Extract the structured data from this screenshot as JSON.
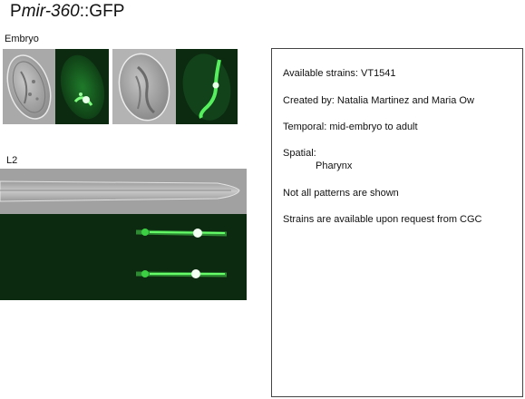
{
  "header": {
    "prefix": "P",
    "gene": "mir-360",
    "suffix": "::GFP"
  },
  "sections": {
    "embryo_label": "Embryo",
    "l2_label": "L2"
  },
  "info": {
    "strains": "Available strains: VT1541",
    "created": "Created by: Natalia Martinez and Maria Ow",
    "temporal": "Temporal: mid-embryo to adult",
    "spatial_label": "Spatial:",
    "spatial_value": "Pharynx",
    "note": "Not all patterns are shown",
    "availability": "Strains are available upon request from CGC"
  },
  "colors": {
    "gfp_green": "#3cff4a",
    "fluor_bg": "#0c2a10",
    "dic_gray": "#a6a6a6",
    "border": "#444444"
  }
}
